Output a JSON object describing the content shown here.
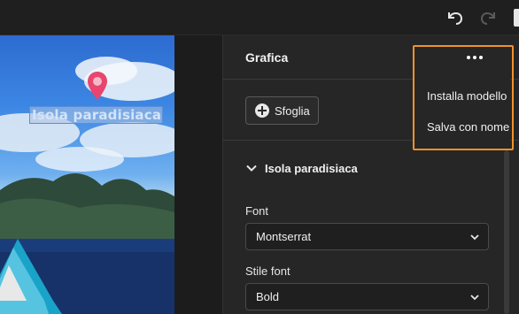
{
  "toolbar": {
    "undo_icon": "undo-icon",
    "redo_icon": "redo-icon"
  },
  "canvas": {
    "caption": "Isola paradisiaca",
    "pin_icon": "map-pin-icon",
    "pin_color": "#e8466f"
  },
  "panel": {
    "title": "Grafica",
    "more_icon": "more-horizontal-icon",
    "browse_label": "Sfoglia",
    "group_title": "Isola paradisiaca",
    "font_label": "Font",
    "font_value": "Montserrat",
    "style_label": "Stile font",
    "style_value": "Bold"
  },
  "menu": {
    "items": [
      "Installa modello",
      "Salva con nome"
    ]
  },
  "colors": {
    "highlight": "#f0922b",
    "panel_bg": "#262626"
  }
}
